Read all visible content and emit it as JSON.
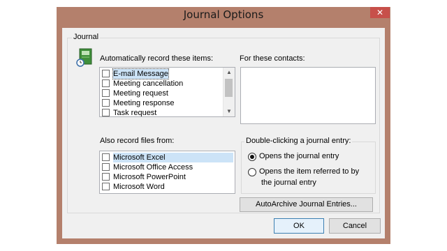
{
  "dialog": {
    "title": "Journal Options",
    "close_glyph": "✕"
  },
  "journal_group": {
    "label": "Journal",
    "auto_record_label": "Automatically record these items:",
    "auto_record_items": [
      {
        "label": "E-mail Message",
        "checked": false,
        "selected": true
      },
      {
        "label": "Meeting cancellation",
        "checked": false
      },
      {
        "label": "Meeting request",
        "checked": false
      },
      {
        "label": "Meeting response",
        "checked": false
      },
      {
        "label": "Task request",
        "checked": false
      }
    ],
    "contacts_label": "For these contacts:",
    "files_label": "Also record files from:",
    "file_items": [
      {
        "label": "Microsoft Excel",
        "checked": false,
        "selected": true
      },
      {
        "label": "Microsoft Office Access",
        "checked": false
      },
      {
        "label": "Microsoft PowerPoint",
        "checked": false
      },
      {
        "label": "Microsoft Word",
        "checked": false
      }
    ],
    "double_click": {
      "legend": "Double-clicking a journal entry:",
      "option1": "Opens the journal entry",
      "option2_line1": "Opens the item referred to by",
      "option2_line2": "the journal entry",
      "selected": "option1"
    },
    "autoarchive_label": "AutoArchive Journal Entries..."
  },
  "buttons": {
    "ok": "OK",
    "cancel": "Cancel"
  },
  "icons": {
    "journal": "journal-book-clock-icon",
    "scroll_up": "▲",
    "scroll_down": "▼"
  }
}
